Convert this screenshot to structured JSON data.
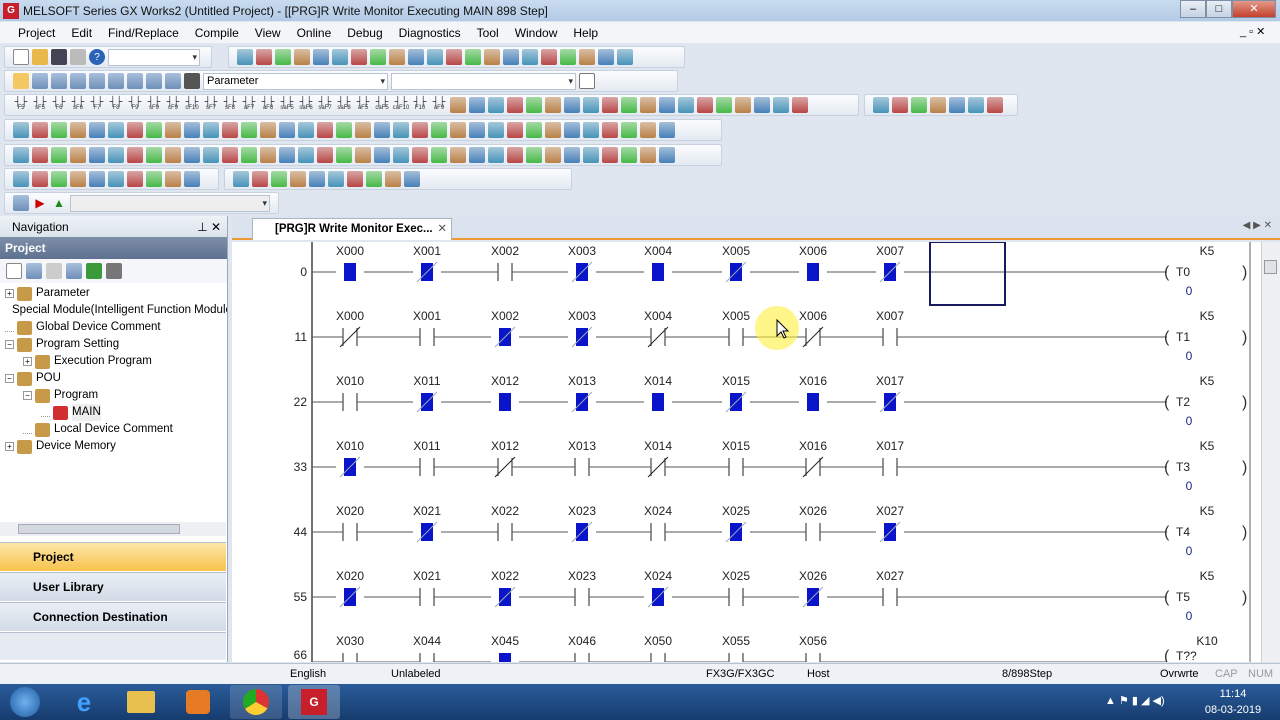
{
  "title": "MELSOFT Series GX Works2 (Untitled Project) - [[PRG]R Write Monitor Executing MAIN 898 Step]",
  "menu": [
    "Project",
    "Edit",
    "Find/Replace",
    "Compile",
    "View",
    "Online",
    "Debug",
    "Diagnostics",
    "Tool",
    "Window",
    "Help"
  ],
  "toolbar": {
    "search_value": "Parameter",
    "ladder_keys": [
      "F5",
      "sF5",
      "F6",
      "sF6",
      "F7",
      "F8",
      "F9",
      "sF9",
      "cF9",
      "cF10",
      "sF7",
      "sF8",
      "aF7",
      "aF8",
      "saF5",
      "saF6",
      "saF7",
      "saF8",
      "aF5",
      "caF5",
      "caF10",
      "F10",
      "aF9"
    ]
  },
  "navigation": {
    "title": "Navigation",
    "section": "Project",
    "tree": [
      {
        "label": "Parameter",
        "level": 0,
        "exp": "+"
      },
      {
        "label": "Special Module(Intelligent Function Module)",
        "level": 0,
        "exp": ""
      },
      {
        "label": "Global Device Comment",
        "level": 0,
        "exp": ""
      },
      {
        "label": "Program Setting",
        "level": 0,
        "exp": "-"
      },
      {
        "label": "Execution Program",
        "level": 1,
        "exp": "+"
      },
      {
        "label": "POU",
        "level": 0,
        "exp": "-"
      },
      {
        "label": "Program",
        "level": 1,
        "exp": "-"
      },
      {
        "label": "MAIN",
        "level": 2,
        "exp": ""
      },
      {
        "label": "Local Device Comment",
        "level": 1,
        "exp": ""
      },
      {
        "label": "Device Memory",
        "level": 0,
        "exp": "+"
      }
    ],
    "buttons": [
      "Project",
      "User Library",
      "Connection Destination"
    ]
  },
  "tab": {
    "label": "[PRG]R Write Monitor Exec..."
  },
  "ladder": {
    "energized_color": "#0a14c8",
    "rungs": [
      {
        "step": "0",
        "contacts": [
          [
            "X000",
            "NO",
            1
          ],
          [
            "X001",
            "NC",
            1
          ],
          [
            "X002",
            "NO",
            0
          ],
          [
            "X003",
            "NC",
            1
          ],
          [
            "X004",
            "NO",
            1
          ],
          [
            "X005",
            "NC",
            1
          ],
          [
            "X006",
            "NO",
            1
          ],
          [
            "X007",
            "NC",
            1
          ]
        ],
        "coil": "T0",
        "k": "K5",
        "value": "0"
      },
      {
        "step": "11",
        "contacts": [
          [
            "X000",
            "NC",
            0
          ],
          [
            "X001",
            "NO",
            0
          ],
          [
            "X002",
            "NC",
            1
          ],
          [
            "X003",
            "NC",
            1
          ],
          [
            "X004",
            "NC",
            0
          ],
          [
            "X005",
            "NO",
            0
          ],
          [
            "X006",
            "NC",
            0
          ],
          [
            "X007",
            "NO",
            0
          ]
        ],
        "coil": "T1",
        "k": "K5",
        "value": "0"
      },
      {
        "step": "22",
        "contacts": [
          [
            "X010",
            "NO",
            0
          ],
          [
            "X011",
            "NC",
            1
          ],
          [
            "X012",
            "NO",
            1
          ],
          [
            "X013",
            "NC",
            1
          ],
          [
            "X014",
            "NO",
            1
          ],
          [
            "X015",
            "NC",
            1
          ],
          [
            "X016",
            "NO",
            1
          ],
          [
            "X017",
            "NC",
            1
          ]
        ],
        "coil": "T2",
        "k": "K5",
        "value": "0"
      },
      {
        "step": "33",
        "contacts": [
          [
            "X010",
            "NC",
            1
          ],
          [
            "X011",
            "NO",
            0
          ],
          [
            "X012",
            "NC",
            0
          ],
          [
            "X013",
            "NO",
            0
          ],
          [
            "X014",
            "NC",
            0
          ],
          [
            "X015",
            "NO",
            0
          ],
          [
            "X016",
            "NC",
            0
          ],
          [
            "X017",
            "NO",
            0
          ]
        ],
        "coil": "T3",
        "k": "K5",
        "value": "0"
      },
      {
        "step": "44",
        "contacts": [
          [
            "X020",
            "NO",
            0
          ],
          [
            "X021",
            "NC",
            1
          ],
          [
            "X022",
            "NO",
            0
          ],
          [
            "X023",
            "NC",
            1
          ],
          [
            "X024",
            "NO",
            0
          ],
          [
            "X025",
            "NC",
            1
          ],
          [
            "X026",
            "NO",
            0
          ],
          [
            "X027",
            "NC",
            1
          ]
        ],
        "coil": "T4",
        "k": "K5",
        "value": "0"
      },
      {
        "step": "55",
        "contacts": [
          [
            "X020",
            "NC",
            1
          ],
          [
            "X021",
            "NO",
            0
          ],
          [
            "X022",
            "NC",
            1
          ],
          [
            "X023",
            "NO",
            0
          ],
          [
            "X024",
            "NC",
            1
          ],
          [
            "X025",
            "NO",
            0
          ],
          [
            "X026",
            "NC",
            1
          ],
          [
            "X027",
            "NO",
            0
          ]
        ],
        "coil": "T5",
        "k": "K5",
        "value": "0"
      },
      {
        "step": "66",
        "contacts": [
          [
            "X030",
            "NO",
            0
          ],
          [
            "X044",
            "NO",
            0
          ],
          [
            "X045",
            "NO",
            1
          ],
          [
            "X046",
            "NO",
            0
          ],
          [
            "X050",
            "NO",
            0
          ],
          [
            "X055",
            "NO",
            0
          ],
          [
            "X056",
            "NO",
            0
          ]
        ],
        "coil": "T??",
        "k": "K10",
        "value": ""
      }
    ]
  },
  "status": {
    "language": "English",
    "label": "Unlabeled",
    "plc": "FX3G/FX3GC",
    "station": "Host",
    "step": "8/898Step",
    "mode": "Ovrwrte",
    "caps": "CAP",
    "num": "NUM"
  },
  "clock": {
    "time": "11:14",
    "date": "08-03-2019"
  }
}
